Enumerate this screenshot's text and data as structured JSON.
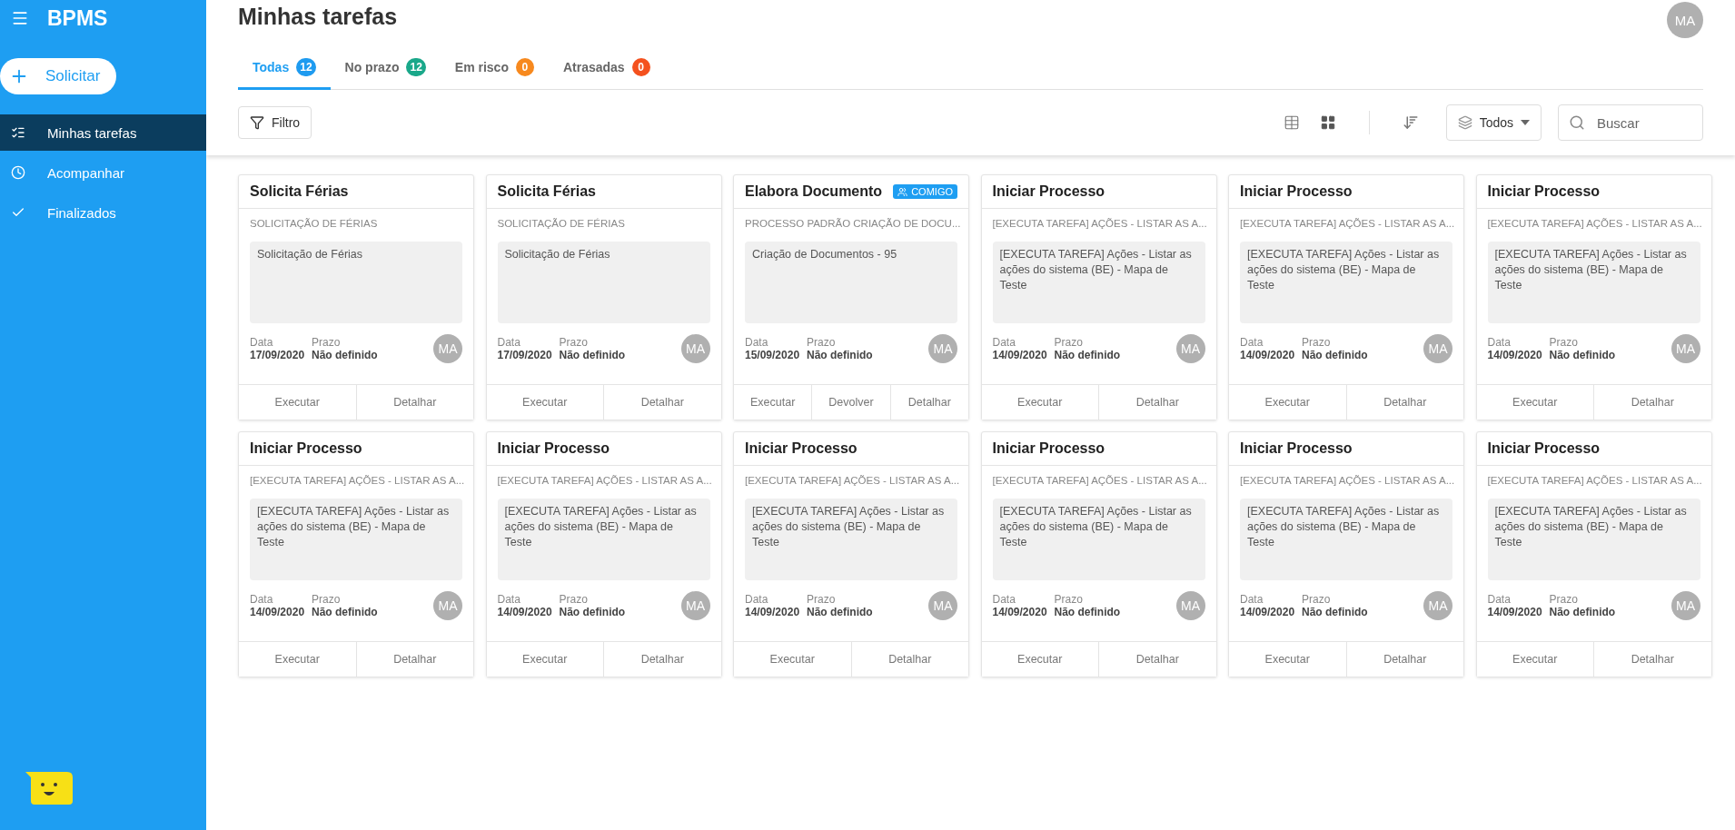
{
  "app": {
    "name": "BPMS",
    "new_button": "Solicitar"
  },
  "sidebar": {
    "items": [
      {
        "kind": "tasks",
        "label": "Minhas tarefas",
        "selected": true
      },
      {
        "kind": "clock",
        "label": "Acompanhar",
        "selected": false
      },
      {
        "kind": "check",
        "label": "Finalizados",
        "selected": false
      }
    ]
  },
  "header": {
    "title": "Minhas tarefas",
    "avatar": "MA"
  },
  "tabs": [
    {
      "label": "Todas",
      "count": "12",
      "color": "#1e9bf0",
      "selected": true
    },
    {
      "label": "No prazo",
      "count": "12",
      "color": "#1aa88a",
      "selected": false
    },
    {
      "label": "Em risco",
      "count": "0",
      "color": "#f7891e",
      "selected": false
    },
    {
      "label": "Atrasadas",
      "count": "0",
      "color": "#f4511e",
      "selected": false
    }
  ],
  "toolbar": {
    "filter": "Filtro",
    "views": [
      {
        "kind": "table",
        "selected": false
      },
      {
        "kind": "grid",
        "selected": true
      }
    ],
    "group": "Todos",
    "search": {
      "placeholder": "Buscar"
    }
  },
  "cards": [
    {
      "title": "Solicita Férias",
      "process": "SOLICITAÇÃO DE FÉRIAS",
      "description": "Solicitação de Férias",
      "date_label": "Data",
      "date": "17/09/2020",
      "deadline_label": "Prazo",
      "deadline": "Não definido",
      "avatar": "MA",
      "actions": [
        "Executar",
        "Detalhar"
      ]
    },
    {
      "title": "Solicita Férias",
      "process": "SOLICITAÇÃO DE FÉRIAS",
      "description": "Solicitação de Férias",
      "date_label": "Data",
      "date": "17/09/2020",
      "deadline_label": "Prazo",
      "deadline": "Não definido",
      "avatar": "MA",
      "actions": [
        "Executar",
        "Detalhar"
      ]
    },
    {
      "title": "Elabora Documento",
      "badge": "COMIGO",
      "process": "PROCESSO PADRÃO CRIAÇÃO DE DOCU...",
      "description": "Criação de Documentos - 95",
      "date_label": "Data",
      "date": "15/09/2020",
      "deadline_label": "Prazo",
      "deadline": "Não definido",
      "avatar": "MA",
      "actions": [
        "Executar",
        "Devolver",
        "Detalhar"
      ]
    },
    {
      "title": "Iniciar Processo",
      "process": "[EXECUTA TAREFA] AÇÕES - LISTAR AS A...",
      "description": "[EXECUTA TAREFA] Ações - Listar as ações do sistema (BE) - Mapa de Teste",
      "date_label": "Data",
      "date": "14/09/2020",
      "deadline_label": "Prazo",
      "deadline": "Não definido",
      "avatar": "MA",
      "actions": [
        "Executar",
        "Detalhar"
      ]
    },
    {
      "title": "Iniciar Processo",
      "process": "[EXECUTA TAREFA] AÇÕES - LISTAR AS A...",
      "description": "[EXECUTA TAREFA] Ações - Listar as ações do sistema (BE) - Mapa de Teste",
      "date_label": "Data",
      "date": "14/09/2020",
      "deadline_label": "Prazo",
      "deadline": "Não definido",
      "avatar": "MA",
      "actions": [
        "Executar",
        "Detalhar"
      ]
    },
    {
      "title": "Iniciar Processo",
      "process": "[EXECUTA TAREFA] AÇÕES - LISTAR AS A...",
      "description": "[EXECUTA TAREFA] Ações - Listar as ações do sistema (BE) - Mapa de Teste",
      "date_label": "Data",
      "date": "14/09/2020",
      "deadline_label": "Prazo",
      "deadline": "Não definido",
      "avatar": "MA",
      "actions": [
        "Executar",
        "Detalhar"
      ]
    },
    {
      "title": "Iniciar Processo",
      "process": "[EXECUTA TAREFA] AÇÕES - LISTAR AS A...",
      "description": "[EXECUTA TAREFA] Ações - Listar as ações do sistema (BE) - Mapa de Teste",
      "date_label": "Data",
      "date": "14/09/2020",
      "deadline_label": "Prazo",
      "deadline": "Não definido",
      "avatar": "MA",
      "actions": [
        "Executar",
        "Detalhar"
      ]
    },
    {
      "title": "Iniciar Processo",
      "process": "[EXECUTA TAREFA] AÇÕES - LISTAR AS A...",
      "description": "[EXECUTA TAREFA] Ações - Listar as ações do sistema (BE) - Mapa de Teste",
      "date_label": "Data",
      "date": "14/09/2020",
      "deadline_label": "Prazo",
      "deadline": "Não definido",
      "avatar": "MA",
      "actions": [
        "Executar",
        "Detalhar"
      ]
    },
    {
      "title": "Iniciar Processo",
      "process": "[EXECUTA TAREFA] AÇÕES - LISTAR AS A...",
      "description": "[EXECUTA TAREFA] Ações - Listar as ações do sistema (BE) - Mapa de Teste",
      "date_label": "Data",
      "date": "14/09/2020",
      "deadline_label": "Prazo",
      "deadline": "Não definido",
      "avatar": "MA",
      "actions": [
        "Executar",
        "Detalhar"
      ]
    },
    {
      "title": "Iniciar Processo",
      "process": "[EXECUTA TAREFA] AÇÕES - LISTAR AS A...",
      "description": "[EXECUTA TAREFA] Ações - Listar as ações do sistema (BE) - Mapa de Teste",
      "date_label": "Data",
      "date": "14/09/2020",
      "deadline_label": "Prazo",
      "deadline": "Não definido",
      "avatar": "MA",
      "actions": [
        "Executar",
        "Detalhar"
      ]
    },
    {
      "title": "Iniciar Processo",
      "process": "[EXECUTA TAREFA] AÇÕES - LISTAR AS A...",
      "description": "[EXECUTA TAREFA] Ações - Listar as ações do sistema (BE) - Mapa de Teste",
      "date_label": "Data",
      "date": "14/09/2020",
      "deadline_label": "Prazo",
      "deadline": "Não definido",
      "avatar": "MA",
      "actions": [
        "Executar",
        "Detalhar"
      ]
    },
    {
      "title": "Iniciar Processo",
      "process": "[EXECUTA TAREFA] AÇÕES - LISTAR AS A...",
      "description": "[EXECUTA TAREFA] Ações - Listar as ações do sistema (BE) - Mapa de Teste",
      "date_label": "Data",
      "date": "14/09/2020",
      "deadline_label": "Prazo",
      "deadline": "Não definido",
      "avatar": "MA",
      "actions": [
        "Executar",
        "Detalhar"
      ]
    }
  ]
}
